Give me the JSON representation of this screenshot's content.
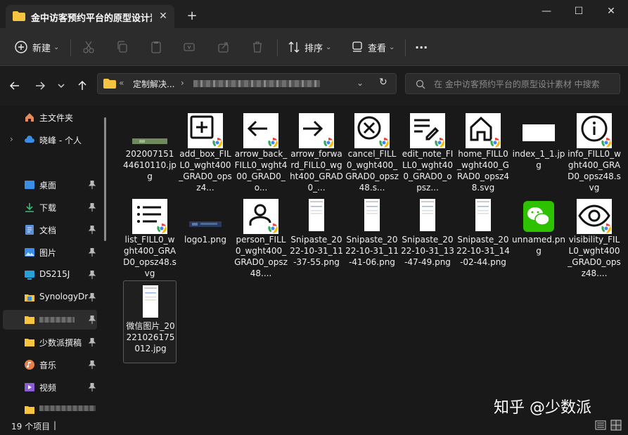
{
  "window": {
    "tab_title": "金中访客预约平台的原型设计素材",
    "tab_close": "✕",
    "new_tab": "+",
    "minimize": "—",
    "maximize": "☐",
    "close": "✕"
  },
  "toolbar": {
    "new_label": "新建",
    "sort_label": "排序",
    "view_label": "查看",
    "more_label": "···"
  },
  "address": {
    "overflow": "«",
    "crumb_1": "定制解决...",
    "chevron": "›",
    "dropdown": "⌄",
    "refresh": "↻"
  },
  "search": {
    "placeholder": "在 金中访客预约平台的原型设计素材 中搜索"
  },
  "sidebar": {
    "items": [
      {
        "label": "主文件夹",
        "icon": "home-icon"
      },
      {
        "label": "晓峰 - 个人",
        "icon": "cloud-icon"
      },
      {
        "label": "桌面",
        "icon": "desktop-icon"
      },
      {
        "label": "下载",
        "icon": "download-icon"
      },
      {
        "label": "文档",
        "icon": "document-icon"
      },
      {
        "label": "图片",
        "icon": "pictures-icon"
      },
      {
        "label": "DS215J",
        "icon": "monitor-icon"
      },
      {
        "label": "SynologyDr",
        "icon": "folder-icon"
      },
      {
        "label": "",
        "icon": "folder-icon"
      },
      {
        "label": "少数派撰稿",
        "icon": "folder-icon"
      },
      {
        "label": "音乐",
        "icon": "music-icon"
      },
      {
        "label": "视频",
        "icon": "video-icon"
      },
      {
        "label": "",
        "icon": "folder-icon"
      }
    ]
  },
  "files": [
    {
      "name": "20200715144610110.jpg",
      "type": "photo"
    },
    {
      "name": "add_box_FILL0_wght400_GRAD0_opsz4...",
      "type": "add"
    },
    {
      "name": "arrow_back_FILL0_wght400_GRAD0_o...",
      "type": "back"
    },
    {
      "name": "arrow_forward_FILL0_wght400_GRAD0_...",
      "type": "forward"
    },
    {
      "name": "cancel_FILL0_wght400_GRAD0_opsz48.s...",
      "type": "cancel"
    },
    {
      "name": "edit_note_FILL0_wght400_GRAD0_opsz...",
      "type": "edit"
    },
    {
      "name": "home_FILL0_wght400_GRAD0_opsz48.svg",
      "type": "home"
    },
    {
      "name": "index_1_1.jpg",
      "type": "blank"
    },
    {
      "name": "info_FILL0_wght400_GRAD0_opsz48.svg",
      "type": "info"
    },
    {
      "name": "list_FILL0_wght400_GRAD0_opsz48.svg",
      "type": "list"
    },
    {
      "name": "logo1.png",
      "type": "logo"
    },
    {
      "name": "person_FILL0_wght400_GRAD0_opsz48....",
      "type": "person"
    },
    {
      "name": "Snipaste_2022-10-31_11-37-55.png",
      "type": "phone"
    },
    {
      "name": "Snipaste_2022-10-31_11-41-06.png",
      "type": "phone"
    },
    {
      "name": "Snipaste_2022-10-31_13-47-49.png",
      "type": "phone"
    },
    {
      "name": "Snipaste_2022-10-31_14-02-44.png",
      "type": "phone"
    },
    {
      "name": "unnamed.png",
      "type": "wechat"
    },
    {
      "name": "visibility_FILL0_wght400_GRAD0_opsz48....",
      "type": "visibility"
    },
    {
      "name": "微信图片_20221026175012.jpg",
      "type": "phone"
    }
  ],
  "status": {
    "count": "19 个项目",
    "divider": "|"
  },
  "watermark": "知乎 @少数派",
  "colors": {
    "folder": "#f5c542",
    "accent": "#4cc2ff"
  }
}
